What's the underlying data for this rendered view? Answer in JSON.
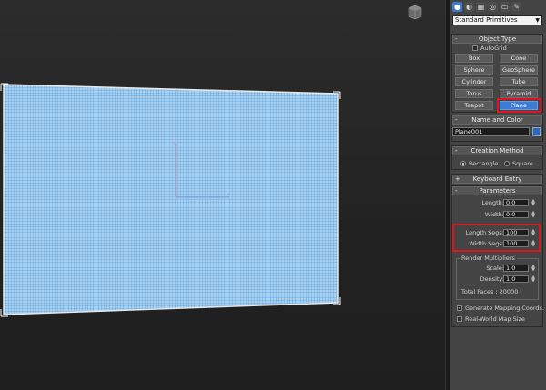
{
  "viewport": {
    "plane_fill": "#a9d2f0",
    "plane_grid": "#5aa0dd",
    "gizmo_x_color": "#8aa4d8",
    "gizmo_y_color": "#c8a0c8"
  },
  "panel": {
    "tabs": [
      {
        "icon": "create-icon",
        "glyph": "●"
      },
      {
        "icon": "modify-icon",
        "glyph": "◐"
      },
      {
        "icon": "hierarchy-icon",
        "glyph": "▦"
      },
      {
        "icon": "motion-icon",
        "glyph": "◎"
      },
      {
        "icon": "display-icon",
        "glyph": "▭"
      },
      {
        "icon": "utilities-icon",
        "glyph": "✎"
      }
    ],
    "category_dropdown": "Standard Primitives",
    "object_type": {
      "title": "Object Type",
      "autogrid_label": "AutoGrid",
      "buttons": [
        "Box",
        "Cone",
        "Sphere",
        "GeoSphere",
        "Cylinder",
        "Tube",
        "Torus",
        "Pyramid",
        "Teapot",
        "Plane"
      ],
      "selected": "Plane"
    },
    "name_and_color": {
      "title": "Name and Color",
      "name_value": "Plane001",
      "color": "#2c67c6"
    },
    "creation_method": {
      "title": "Creation Method",
      "options": [
        "Rectangle",
        "Square"
      ],
      "selected": "Rectangle"
    },
    "keyboard_entry": {
      "title": "Keyboard Entry"
    },
    "parameters": {
      "title": "Parameters",
      "length_label": "Length:",
      "length_value": "0.0",
      "width_label": "Width:",
      "width_value": "0.0",
      "length_segs_label": "Length Segs:",
      "length_segs_value": "100",
      "width_segs_label": "Width Segs:",
      "width_segs_value": "100",
      "render_multipliers_title": "Render Multipliers",
      "scale_label": "Scale:",
      "scale_value": "1.0",
      "density_label": "Density:",
      "density_value": "1.0",
      "total_faces": "Total Faces : 20000",
      "generate_mapping_label": "Generate Mapping Coords.",
      "generate_mapping_checked": true,
      "real_world_label": "Real-World Map Size",
      "real_world_checked": false
    },
    "highlight_color": "#e0141c"
  }
}
